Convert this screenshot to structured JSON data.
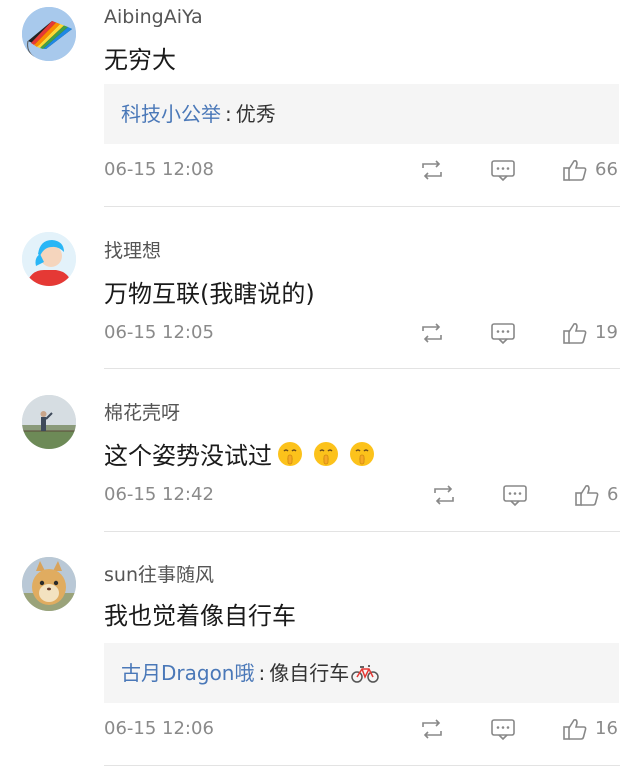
{
  "comments": [
    {
      "username": "AibingAiYa",
      "text": "无穷大",
      "reply": {
        "user": "科技小公举",
        "separator": ":",
        "text": "优秀"
      },
      "time": "06-15 12:08",
      "likes": "66",
      "avatar_icon": "kite-icon"
    },
    {
      "username": "找理想",
      "text": "万物互联(我瞎说的)",
      "time": "06-15 12:05",
      "likes": "19",
      "avatar_icon": "person-illustration-icon"
    },
    {
      "username": "棉花壳呀",
      "text": "这个姿势没试过",
      "emoji_count": 3,
      "time": "06-15 12:42",
      "likes": "6",
      "avatar_icon": "person-outdoor-photo-icon"
    },
    {
      "username": "sun往事随风",
      "text": "我也觉着像自行车",
      "reply": {
        "user": "古月Dragon哦",
        "separator": ":",
        "text": "像自行车"
      },
      "time": "06-15 12:06",
      "likes": "16",
      "avatar_icon": "cat-photo-icon"
    }
  ],
  "colors": {
    "reply_user": "#4a78b8",
    "meta": "#8a8a8a",
    "reply_bg": "#f5f5f5",
    "divider": "#e3e3e3"
  }
}
